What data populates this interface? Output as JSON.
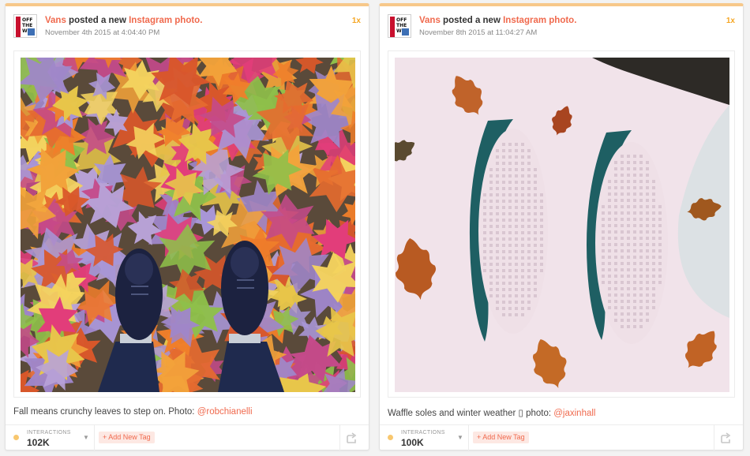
{
  "posts": [
    {
      "brand": "Vans",
      "action": " posted a new ",
      "post_type": "Instagram photo.",
      "timestamp": "November 4th 2015 at 4:04:40 PM",
      "multiplier": "1x",
      "logo": {
        "line1": "OFF",
        "line2": "THE",
        "line3": "W"
      },
      "caption_text": "Fall means crunchy leaves to step on. Photo: ",
      "caption_mention": "@robchianelli",
      "interactions_label": "INTERACTIONS",
      "interactions_value": "102K",
      "tag_button": "+ Add New Tag",
      "icon": "share-icon"
    },
    {
      "brand": "Vans",
      "action": " posted a new ",
      "post_type": "Instagram photo.",
      "timestamp": "November 8th 2015 at 11:04:27 AM",
      "multiplier": "1x",
      "logo": {
        "line1": "OFF",
        "line2": "THE",
        "line3": "W"
      },
      "caption_text": "Waffle soles and winter weather ▯ photo: ",
      "caption_mention": "@jaxinhall",
      "interactions_label": "INTERACTIONS",
      "interactions_value": "100K",
      "tag_button": "+ Add New Tag",
      "icon": "share-icon"
    }
  ],
  "colors": {
    "accent": "#f06a4e",
    "top_border": "#f7c88a",
    "multiplier": "#f5a623",
    "dot": "#f8c76f"
  }
}
